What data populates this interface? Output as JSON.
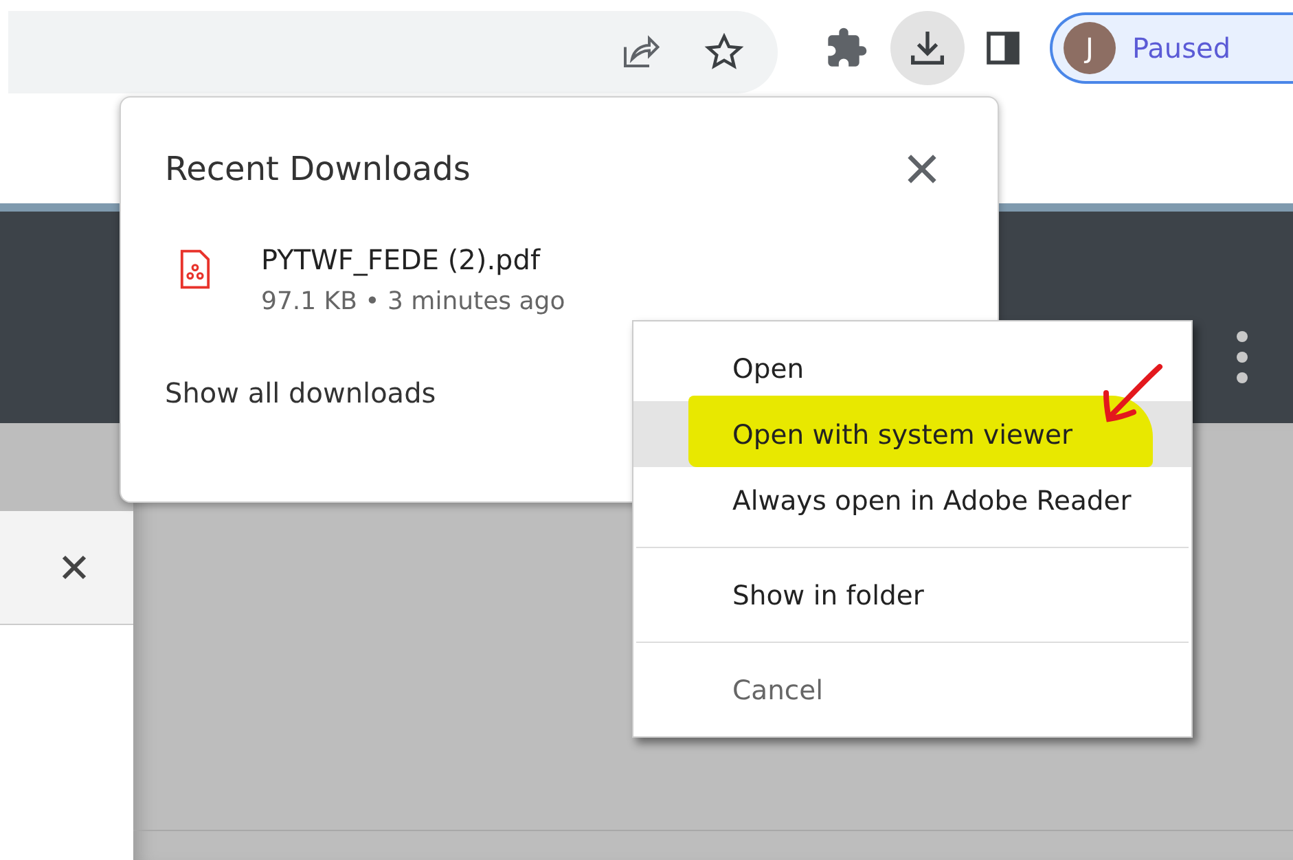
{
  "toolbar": {
    "download_active": true,
    "profile": {
      "initial": "J",
      "status": "Paused"
    }
  },
  "downloads_popup": {
    "title": "Recent Downloads",
    "file": {
      "name": "PYTWF_FEDE (2).pdf",
      "meta": "97.1 KB • 3 minutes ago"
    },
    "show_all": "Show all downloads"
  },
  "context_menu": {
    "groups": [
      [
        {
          "label": "Open",
          "selected": false,
          "disabled": false,
          "marked": false
        },
        {
          "label": "Open with system viewer",
          "selected": true,
          "disabled": false,
          "marked": true
        },
        {
          "label": "Always open in Adobe Reader",
          "selected": false,
          "disabled": false,
          "marked": false
        }
      ],
      [
        {
          "label": "Show in folder",
          "selected": false,
          "disabled": false,
          "marked": false
        }
      ],
      [
        {
          "label": "Cancel",
          "selected": false,
          "disabled": true,
          "marked": false
        }
      ]
    ]
  }
}
